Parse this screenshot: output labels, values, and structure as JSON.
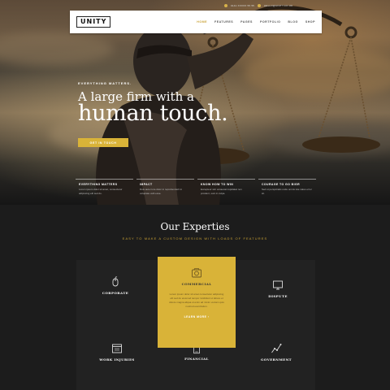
{
  "topbar": {
    "phone": "0141 XXXXX 55 55",
    "email": "HELLO@UNITY.CO.UK"
  },
  "brand": {
    "logo": "UNITY"
  },
  "nav": {
    "items": [
      "HOME",
      "FEATURES",
      "PAGES",
      "PORTFOLIO",
      "BLOG",
      "SHOP"
    ],
    "active": "HOME"
  },
  "hero": {
    "eyebrow": "EVERYTHING MATTERS.",
    "headline_small": "A large firm with a",
    "headline_big": "human touch.",
    "cta": "GET IN TOUCH"
  },
  "features": [
    {
      "title": "EVERYTHING MATTERS",
      "text": "Lorem ipsum dolor sit amet, consectetur adipiscing elit sed do."
    },
    {
      "title": "IMPACT",
      "text": "Duis aute irure dolor in reprehenderit in voluptate velit esse."
    },
    {
      "title": "KNOW HOW TO WIN",
      "text": "Excepteur sint occaecat cupidatat non proident, sunt in culpa."
    },
    {
      "title": "COURAGE TO GO BIGR",
      "text": "Sed ut perspiciatis unde omnis iste natus error sit."
    }
  ],
  "experties": {
    "title": "Our Experties",
    "subtitle": "EASY TO MAKE A CUSTOM DESIGN WITH LOADS OF FEATURES",
    "items": {
      "corporate": "CORPORATE",
      "commercial": "COMMERCIAL",
      "dispute": "DISPUTE",
      "work_injuries": "WORK INJURIES",
      "financial": "FINANCIAL",
      "government": "GOVERNMENT"
    },
    "featured_text": "Lorem ipsum dolor sit amet consectetur adipiscing elit sed do eiusmod tempor incididunt ut labore et dolore magna aliqua ut enim ad minim veniam quis nostrud exercitation.",
    "learn_more": "LEARN MORE  ›"
  },
  "colors": {
    "accent": "#d9b338",
    "dark": "#1c1c1c"
  }
}
